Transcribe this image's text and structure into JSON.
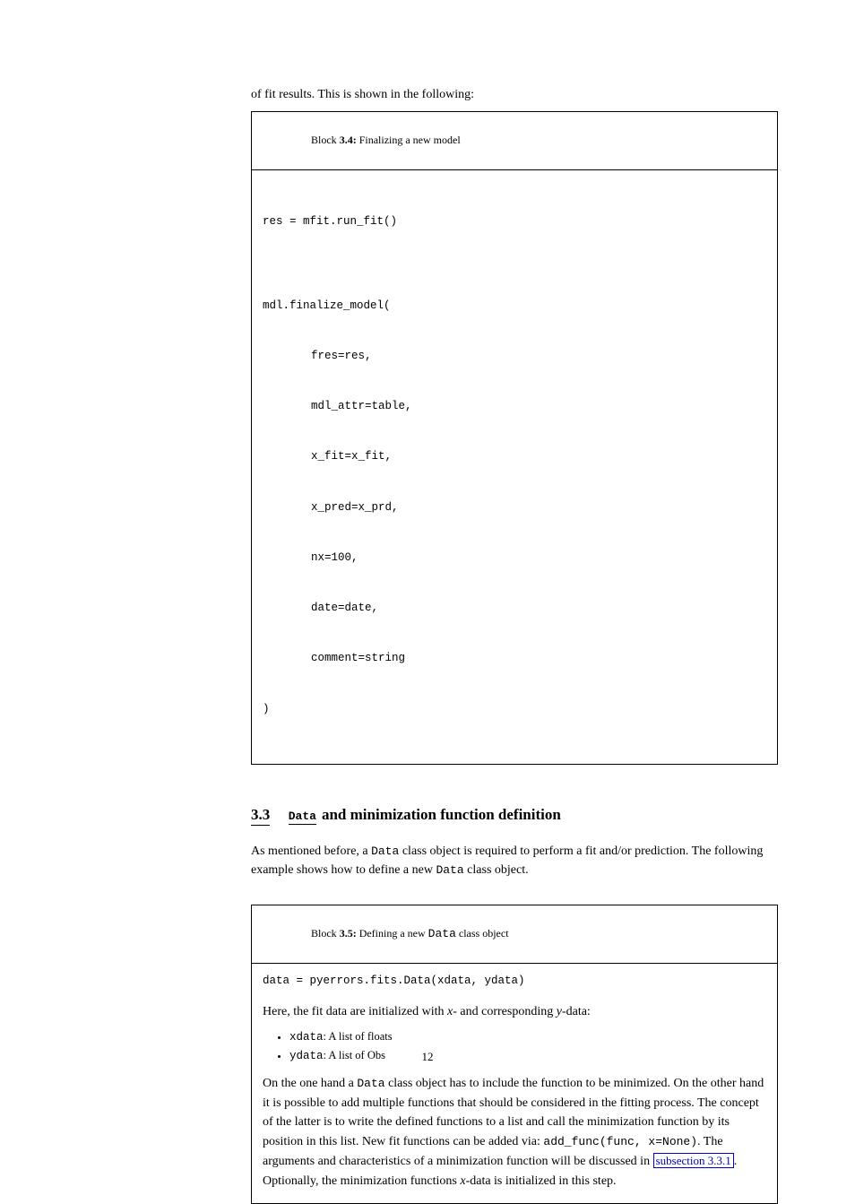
{
  "intro_line": "of fit results. This is shown in the following:",
  "box34": {
    "label_prefix": "Block ",
    "label_num": "3.4:",
    "label_suffix": " Finalizing a new model",
    "lines": [
      "res = mfit.run_fit()",
      "",
      "mdl.finalize_model(",
      "    fres=res,",
      "    mdl_attr=table,",
      "    x_fit=x_fit,",
      "    x_pred=x_prd,",
      "    nx=100,",
      "    date=date,",
      "    comment=string",
      ")"
    ]
  },
  "heading": {
    "num": "3.3",
    "dtype": "Data",
    "rest": "and minimization function definition"
  },
  "para1_parts": [
    "As mentioned before, a ",
    "Data",
    " class object is required to perform a fit and/or prediction. The following example shows how to define a new ",
    "Data",
    " class object."
  ],
  "box35": {
    "label_prefix": "Block ",
    "label_num": "3.5:",
    "label_suffix": " Defining a new ",
    "label_mono": "Data",
    "label_tail": " class object",
    "line1": "data = pyerrors.fits.Data(xdata, ydata)",
    "line2_pre": "Here, the fit data are initialized with ",
    "line2_x": "x",
    "line2_mid": "- and corresponding ",
    "line2_y": "y",
    "line2_post": "-data:",
    "bullets": [
      {
        "name": "xdata",
        "desc": ": A list of floats"
      },
      {
        "name": "ydata",
        "desc": ": A list of Obs"
      }
    ],
    "para_parts": [
      "On the one hand a ",
      "Data",
      " class object has to include the function to be minimized. On the other hand it is possible to add multiple functions that should be considered in the fitting process. The concept of the latter is to write the defined functions to a list and call the minimization function by its position in this list. New fit functions can be added via: ",
      "add_func(func, x=None)",
      ". The arguments and characteristics of a minimization function will be discussed in "
    ],
    "xref_text": "subsection 3.3.1",
    "after_xref_parts": [
      ". Optionally, the minimization functions ",
      "x",
      "-data is initialized in this step."
    ]
  },
  "page_number": "12"
}
